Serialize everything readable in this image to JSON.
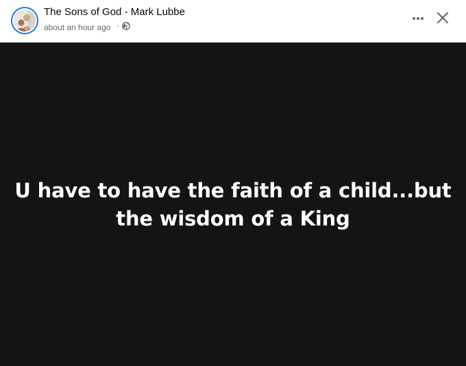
{
  "post": {
    "page_title": "The Sons of God - Mark Lubbe",
    "timestamp": "about an hour ago",
    "separator": "·",
    "privacy_icon": "globe-icon",
    "text": "U have to have the faith of a child...but the wisdom of a King"
  },
  "header": {
    "more_icon": "more-options-icon",
    "close_icon": "close-icon"
  },
  "colors": {
    "content_background": "#141414",
    "post_text": "#ffffff",
    "avatar_ring": "#1877f2",
    "secondary_text": "#65676b"
  }
}
